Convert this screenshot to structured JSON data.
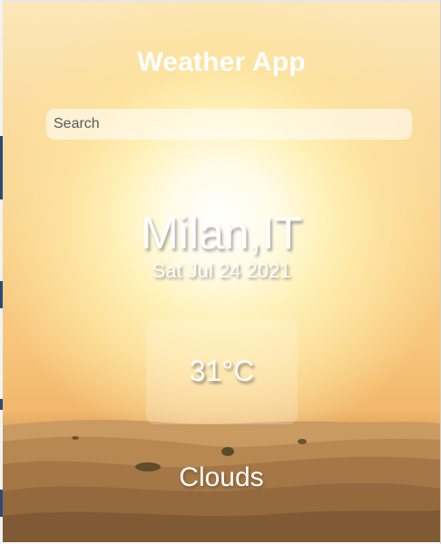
{
  "app": {
    "title": "Weather App"
  },
  "search": {
    "placeholder": "Search",
    "value": ""
  },
  "location": {
    "name": "Milan,IT",
    "date": "Sat Jul 24 2021"
  },
  "weather": {
    "temperature": "31°C",
    "condition": "Clouds"
  },
  "colors": {
    "text": "#ffffff",
    "sky_top": "#fbe7b8",
    "sun": "#ffffff",
    "sand": "#a77a48"
  }
}
